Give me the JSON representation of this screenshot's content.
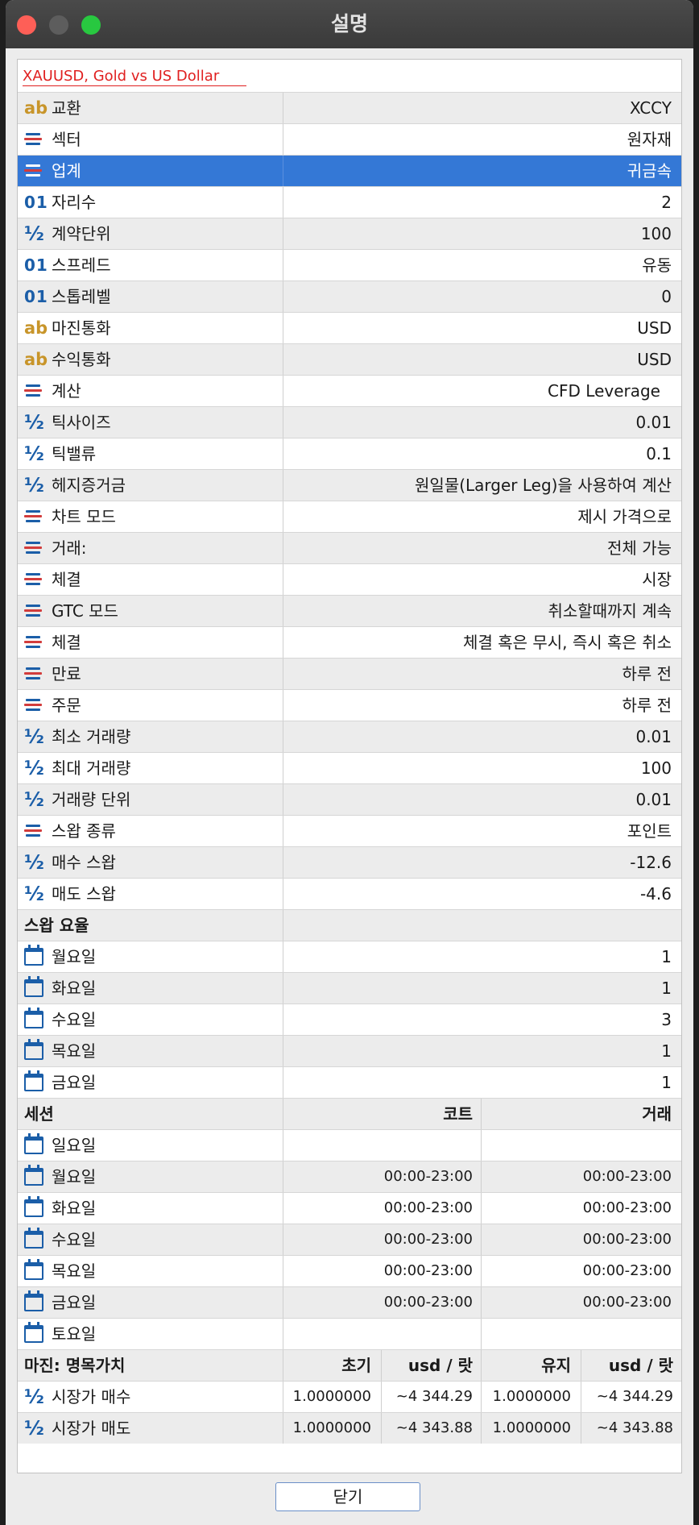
{
  "window": {
    "title": "설명"
  },
  "header": {
    "symbol_link": "XAUUSD, Gold vs US Dollar"
  },
  "specs": [
    {
      "icon": "ab",
      "label": "교환",
      "value": "XCCY"
    },
    {
      "icon": "list",
      "label": "섹터",
      "value": "원자재"
    },
    {
      "icon": "list",
      "label": "업계",
      "value": "귀금속",
      "selected": true
    },
    {
      "icon": "01",
      "label": "자리수",
      "value": "2"
    },
    {
      "icon": "half",
      "label": "계약단위",
      "value": "100"
    },
    {
      "icon": "01",
      "label": "스프레드",
      "value": "유동"
    },
    {
      "icon": "01",
      "label": "스톱레벨",
      "value": "0"
    },
    {
      "icon": "ab",
      "label": "마진통화",
      "value": "USD"
    },
    {
      "icon": "ab",
      "label": "수익통화",
      "value": "USD"
    },
    {
      "icon": "list",
      "label": "계산",
      "value": "CFD Leverage"
    },
    {
      "icon": "half",
      "label": "틱사이즈",
      "value": "0.01"
    },
    {
      "icon": "half",
      "label": "틱밸류",
      "value": "0.1"
    },
    {
      "icon": "half",
      "label": "헤지증거금",
      "value": "원일물(Larger Leg)을 사용하여 계산"
    },
    {
      "icon": "list",
      "label": "차트 모드",
      "value": "제시 가격으로"
    },
    {
      "icon": "list",
      "label": "거래:",
      "value": "전체 가능"
    },
    {
      "icon": "list",
      "label": "체결",
      "value": "시장"
    },
    {
      "icon": "list",
      "label": "GTC 모드",
      "value": "취소할때까지 계속"
    },
    {
      "icon": "list",
      "label": "체결",
      "value": "체결 혹은 무시, 즉시 혹은 취소"
    },
    {
      "icon": "list",
      "label": "만료",
      "value": "하루 전"
    },
    {
      "icon": "list",
      "label": "주문",
      "value": "하루 전"
    },
    {
      "icon": "half",
      "label": "최소 거래량",
      "value": "0.01"
    },
    {
      "icon": "half",
      "label": "최대 거래량",
      "value": "100"
    },
    {
      "icon": "half",
      "label": "거래량 단위",
      "value": "0.01"
    },
    {
      "icon": "list",
      "label": "스왑 종류",
      "value": "포인트"
    },
    {
      "icon": "half",
      "label": "매수 스왑",
      "value": "-12.6"
    },
    {
      "icon": "half",
      "label": "매도 스왑",
      "value": "-4.6"
    }
  ],
  "swap_rates": {
    "title": "스왑 요율",
    "days": [
      {
        "label": "월요일",
        "value": "1"
      },
      {
        "label": "화요일",
        "value": "1"
      },
      {
        "label": "수요일",
        "value": "3"
      },
      {
        "label": "목요일",
        "value": "1"
      },
      {
        "label": "금요일",
        "value": "1"
      }
    ]
  },
  "sessions": {
    "title": "세션",
    "col_quote": "코트",
    "col_trade": "거래",
    "days": [
      {
        "label": "일요일",
        "quote": "",
        "trade": ""
      },
      {
        "label": "월요일",
        "quote": "00:00-23:00",
        "trade": "00:00-23:00"
      },
      {
        "label": "화요일",
        "quote": "00:00-23:00",
        "trade": "00:00-23:00"
      },
      {
        "label": "수요일",
        "quote": "00:00-23:00",
        "trade": "00:00-23:00"
      },
      {
        "label": "목요일",
        "quote": "00:00-23:00",
        "trade": "00:00-23:00"
      },
      {
        "label": "금요일",
        "quote": "00:00-23:00",
        "trade": "00:00-23:00"
      },
      {
        "label": "토요일",
        "quote": "",
        "trade": ""
      }
    ]
  },
  "margin": {
    "title": "마진: 명목가치",
    "col_initial": "초기",
    "col_initial_unit": "usd / 랏",
    "col_maint": "유지",
    "col_maint_unit": "usd / 랏",
    "rows": [
      {
        "label": "시장가 매수",
        "initial": "1.0000000",
        "initial_usd": "~4 344.29",
        "maint": "1.0000000",
        "maint_usd": "~4 344.29"
      },
      {
        "label": "시장가 매도",
        "initial": "1.0000000",
        "initial_usd": "~4 343.88",
        "maint": "1.0000000",
        "maint_usd": "~4 343.88"
      }
    ]
  },
  "footer": {
    "close_label": "닫기"
  }
}
